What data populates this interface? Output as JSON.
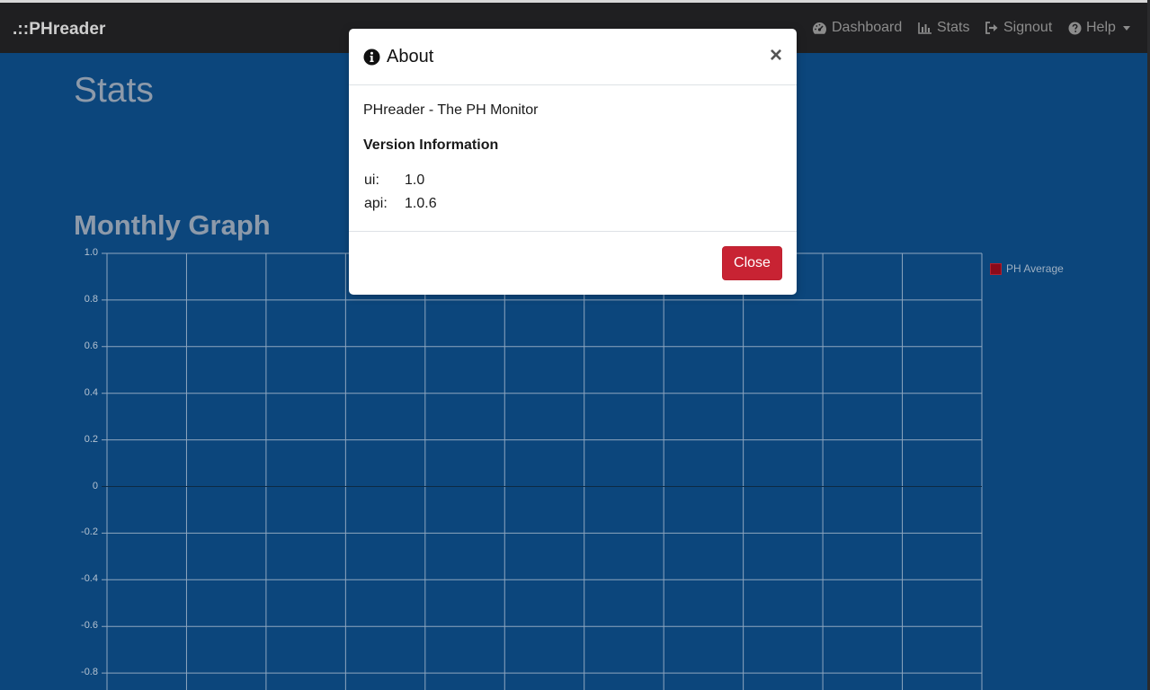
{
  "app": {
    "brand": ".::PHreader"
  },
  "nav": {
    "items": [
      {
        "label": "Dashboard",
        "icon": "gauge-icon"
      },
      {
        "label": "Stats",
        "icon": "bar-chart-icon"
      },
      {
        "label": "Signout",
        "icon": "sign-out-icon"
      },
      {
        "label": "Help",
        "icon": "question-circle-icon"
      }
    ]
  },
  "page": {
    "title": "Stats",
    "section_title": "Monthly Graph"
  },
  "colors": {
    "navbar": "#1f1f21",
    "background": "#0c467c",
    "series": "#8b0a1a",
    "danger_button": "#c82333"
  },
  "chart_data": {
    "type": "line",
    "title": "",
    "xlabel": "",
    "ylabel": "",
    "ylim": [
      -0.8,
      1.0
    ],
    "yticks": [
      "1.0",
      "0.8",
      "0.6",
      "0.4",
      "0.2",
      "0",
      "-0.2",
      "-0.4",
      "-0.6",
      "-0.8"
    ],
    "x_gridlines": 11,
    "grid": true,
    "legend_position": "right",
    "series": [
      {
        "name": "PH Average",
        "values": []
      }
    ]
  },
  "modal": {
    "title": "About",
    "description": "PHreader - The PH Monitor",
    "version_heading": "Version Information",
    "versions": [
      {
        "key": "ui:",
        "value": "1.0"
      },
      {
        "key": "api:",
        "value": "1.0.6"
      }
    ],
    "close_label": "Close",
    "close_x": "×"
  }
}
